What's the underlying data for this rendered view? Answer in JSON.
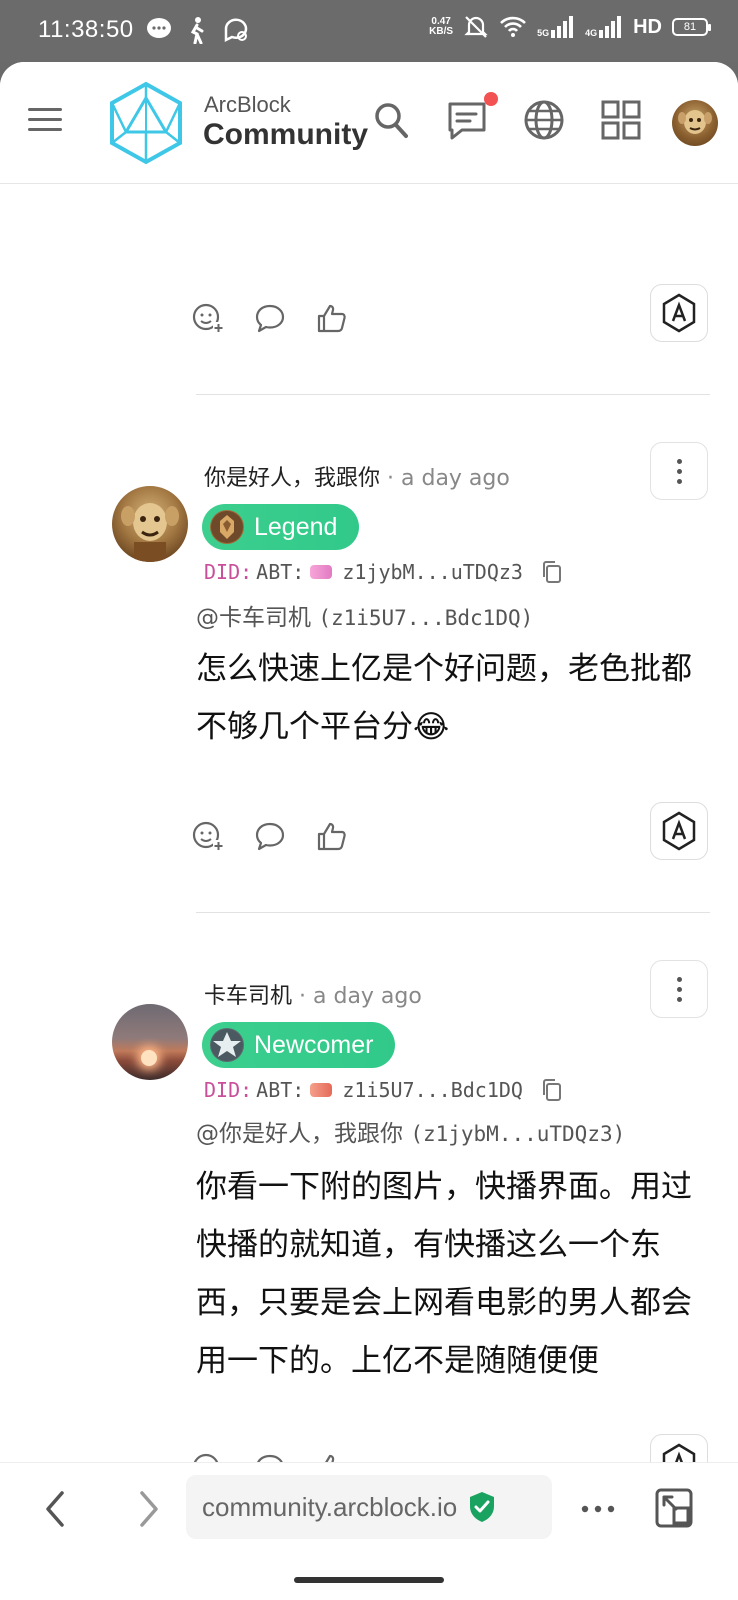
{
  "status_bar": {
    "time": "11:38:50",
    "net_speed_value": "0.47",
    "net_speed_unit": "KB/S",
    "net_5g": "5G",
    "net_4g": "4G",
    "hd": "HD",
    "battery": "81"
  },
  "header": {
    "brand_top": "ArcBlock",
    "brand_main": "Community",
    "icons": [
      "menu-icon",
      "search-icon",
      "chat-icon",
      "globe-icon",
      "apps-grid-icon"
    ]
  },
  "posts": [
    {
      "author": "你是好人，我跟你",
      "time": "· a day ago",
      "badge": "Legend",
      "did_prefix": "DID:",
      "did_abt": "ABT:",
      "did_value": "z1jybM...uTDQz3",
      "mention_name": "@卡车司机",
      "mention_did": "(z1i5U7...Bdc1DQ)",
      "body": "怎么快速上亿是个好问题，老色批都不够几个平台分😂"
    },
    {
      "author": "卡车司机",
      "time": "· a day ago",
      "badge": "Newcomer",
      "did_prefix": "DID:",
      "did_abt": "ABT:",
      "did_value": "z1i5U7...Bdc1DQ",
      "mention_name": "@你是好人，我跟你",
      "mention_did": "(z1jybM...uTDQz3)",
      "body": "你看一下附的图片，快播界面。用过快播的就知道，有快播这么一个东西，只要是会上网看电影的男人都会用一下的。上亿不是随随便便"
    }
  ],
  "browser": {
    "url": "community.arcblock.io"
  },
  "colors": {
    "badge_green": "#3ccf8e",
    "did_pink": "#c94f9a",
    "notification_red": "#f25252",
    "secure_green": "#1aa260"
  }
}
